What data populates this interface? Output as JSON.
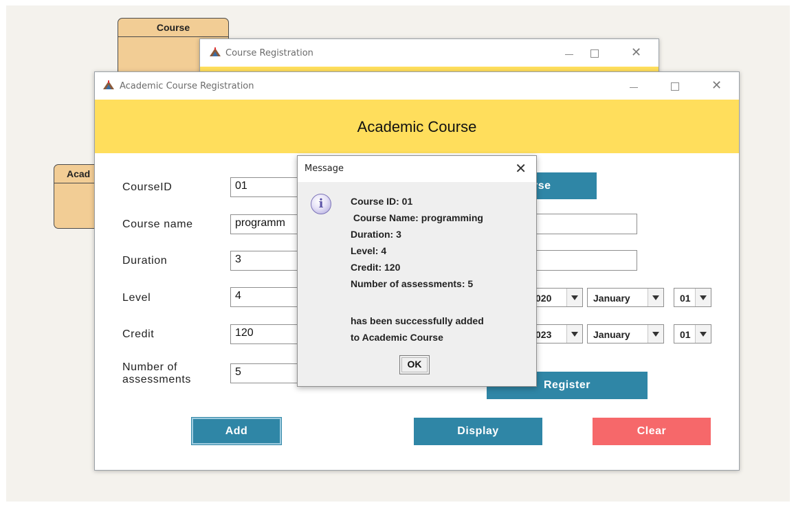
{
  "uml": {
    "course_title": "Course",
    "academic_title": "Acad"
  },
  "back_window": {
    "title": "Course Registration"
  },
  "main_window": {
    "title": "Academic Course Registration",
    "banner_title": "Academic Course"
  },
  "form": {
    "labels": {
      "course_id": "CourseID",
      "course_name": "Course name",
      "duration": "Duration",
      "level": "Level",
      "credit": "Credit",
      "assessments_line1": "Number of",
      "assessments_line2": "assessments"
    },
    "values": {
      "course_id": "01",
      "course_name": "programm",
      "duration": "3",
      "level": "4",
      "credit": "120",
      "assessments": "5"
    }
  },
  "right_panel": {
    "top_button_label_partial": "rse",
    "start_date": {
      "year": "020",
      "month": "January",
      "day": "01"
    },
    "end_date": {
      "year": "023",
      "month": "January",
      "day": "01"
    },
    "register_label": "Register"
  },
  "buttons": {
    "add": "Add",
    "display": "Display",
    "clear": "Clear"
  },
  "dialog": {
    "title": "Message",
    "close_glyph": "✕",
    "icon_glyph": "i",
    "lines": [
      "Course ID: 01",
      " Course Name: programming",
      "Duration: 3",
      "Level: 4",
      "Credit: 120",
      "Number of assessments: 5",
      "has been successfully added",
      "to Academic Course"
    ],
    "ok_label": "OK"
  },
  "window_controls": {
    "close_glyph": "✕"
  },
  "colors": {
    "banner": "#ffde5c",
    "primary_button": "#2f86a6",
    "clear_button": "#f6686a",
    "uml_fill": "#f2cd95"
  }
}
